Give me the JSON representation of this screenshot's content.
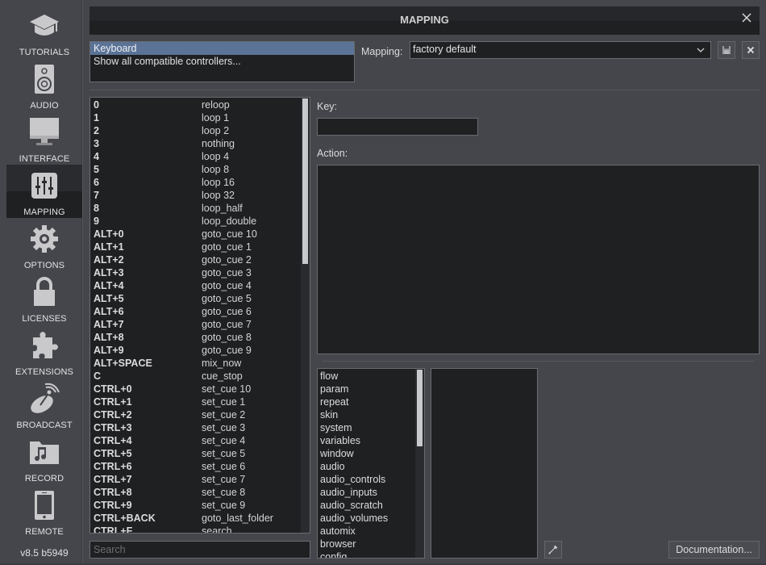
{
  "window": {
    "title": "MAPPING",
    "version": "v8.5 b5949"
  },
  "sidebar": {
    "items": [
      {
        "label": "TUTORIALS",
        "icon": "graduation-cap-icon",
        "active": false
      },
      {
        "label": "AUDIO",
        "icon": "speaker-icon",
        "active": false
      },
      {
        "label": "INTERFACE",
        "icon": "monitor-icon",
        "active": false
      },
      {
        "label": "MAPPING",
        "icon": "sliders-icon",
        "active": true
      },
      {
        "label": "OPTIONS",
        "icon": "gear-icon",
        "active": false
      },
      {
        "label": "LICENSES",
        "icon": "lock-icon",
        "active": false
      },
      {
        "label": "EXTENSIONS",
        "icon": "puzzle-icon",
        "active": false
      },
      {
        "label": "BROADCAST",
        "icon": "satellite-dish-icon",
        "active": false
      },
      {
        "label": "RECORD",
        "icon": "music-folder-icon",
        "active": false
      },
      {
        "label": "REMOTE",
        "icon": "tablet-icon",
        "active": false
      }
    ]
  },
  "controllers": {
    "items": [
      "Keyboard",
      "Show all compatible controllers..."
    ],
    "selected": "Keyboard"
  },
  "mapping": {
    "label": "Mapping:",
    "value": "factory default",
    "save_icon": "floppy-disk-icon",
    "delete_icon": "close-icon"
  },
  "keymap": {
    "rows": [
      {
        "key": "0",
        "action": "reloop"
      },
      {
        "key": "1",
        "action": "loop 1"
      },
      {
        "key": "2",
        "action": "loop 2"
      },
      {
        "key": "3",
        "action": "nothing"
      },
      {
        "key": "4",
        "action": "loop 4"
      },
      {
        "key": "5",
        "action": "loop 8"
      },
      {
        "key": "6",
        "action": "loop 16"
      },
      {
        "key": "7",
        "action": "loop 32"
      },
      {
        "key": "8",
        "action": "loop_half"
      },
      {
        "key": "9",
        "action": "loop_double"
      },
      {
        "key": "ALT+0",
        "action": "goto_cue 10"
      },
      {
        "key": "ALT+1",
        "action": "goto_cue 1"
      },
      {
        "key": "ALT+2",
        "action": "goto_cue 2"
      },
      {
        "key": "ALT+3",
        "action": "goto_cue 3"
      },
      {
        "key": "ALT+4",
        "action": "goto_cue 4"
      },
      {
        "key": "ALT+5",
        "action": "goto_cue 5"
      },
      {
        "key": "ALT+6",
        "action": "goto_cue 6"
      },
      {
        "key": "ALT+7",
        "action": "goto_cue 7"
      },
      {
        "key": "ALT+8",
        "action": "goto_cue 8"
      },
      {
        "key": "ALT+9",
        "action": "goto_cue 9"
      },
      {
        "key": "ALT+SPACE",
        "action": "mix_now"
      },
      {
        "key": "C",
        "action": "cue_stop"
      },
      {
        "key": "CTRL+0",
        "action": "set_cue 10"
      },
      {
        "key": "CTRL+1",
        "action": "set_cue 1"
      },
      {
        "key": "CTRL+2",
        "action": "set_cue 2"
      },
      {
        "key": "CTRL+3",
        "action": "set_cue 3"
      },
      {
        "key": "CTRL+4",
        "action": "set_cue 4"
      },
      {
        "key": "CTRL+5",
        "action": "set_cue 5"
      },
      {
        "key": "CTRL+6",
        "action": "set_cue 6"
      },
      {
        "key": "CTRL+7",
        "action": "set_cue 7"
      },
      {
        "key": "CTRL+8",
        "action": "set_cue 8"
      },
      {
        "key": "CTRL+9",
        "action": "set_cue 9"
      },
      {
        "key": "CTRL+BACK",
        "action": "goto_last_folder"
      },
      {
        "key": "CTRL+F",
        "action": "search"
      }
    ],
    "search_placeholder": "Search"
  },
  "editor": {
    "key_label": "Key:",
    "key_value": "",
    "action_label": "Action:",
    "action_value": ""
  },
  "categories": {
    "items": [
      "flow",
      "param",
      "repeat",
      "skin",
      "system",
      "variables",
      "window",
      "audio",
      "audio_controls",
      "audio_inputs",
      "audio_scratch",
      "audio_volumes",
      "automix",
      "browser",
      "config"
    ]
  },
  "footer": {
    "picker_icon": "eyedropper-icon",
    "documentation_label": "Documentation..."
  }
}
